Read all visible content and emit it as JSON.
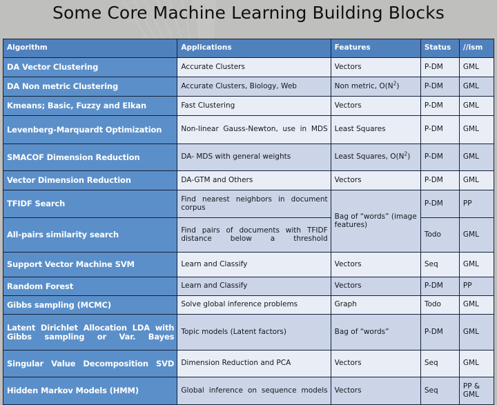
{
  "page": {
    "title": "Some Core Machine Learning Building Blocks",
    "background_color": "#bfbfbd",
    "accent_color": "#4f81bd",
    "algorithm_column_color": "#5b8fc9",
    "row_light_color": "#e9edf6",
    "row_dark_color": "#ccd5e8"
  },
  "table": {
    "columns": [
      "Algorithm",
      "Applications",
      "Features",
      "Status",
      "//ism"
    ],
    "rows": [
      {
        "algorithm": "DA Vector Clustering",
        "applications": "Accurate Clusters",
        "features": "Vectors",
        "status": "P-DM",
        "ism": "GML"
      },
      {
        "algorithm": "DA Non metric Clustering",
        "applications": "Accurate Clusters, Biology, Web",
        "features": "Non metric, O(N2)",
        "features_base": "Non metric, O(N",
        "features_sup": "2",
        "features_tail": ")",
        "status": "P-DM",
        "ism": "GML"
      },
      {
        "algorithm": "Kmeans; Basic, Fuzzy and Elkan",
        "applications": "Fast Clustering",
        "features": "Vectors",
        "status": "P-DM",
        "ism": "GML"
      },
      {
        "algorithm": "Levenberg-Marquardt Optimization",
        "applications": "Non-linear Gauss-Newton, use in MDS",
        "features": "Least Squares",
        "status": "P-DM",
        "ism": "GML"
      },
      {
        "algorithm": "SMACOF Dimension Reduction",
        "applications": "DA- MDS with general weights",
        "features": "Least Squares, O(N2)",
        "features_base": "Least         Squares, O(N",
        "features_sup": "2",
        "features_tail": ")",
        "status": "P-DM",
        "ism": "GML"
      },
      {
        "algorithm": "Vector Dimension Reduction",
        "applications": "DA-GTM and Others",
        "features": "Vectors",
        "status": "P-DM",
        "ism": "GML"
      },
      {
        "algorithm": "TFIDF Search",
        "applications": "Find nearest neighbors in document corpus",
        "features": "Bag of “words” (image features)",
        "features_rowspan": 2,
        "status": "P-DM",
        "ism": "PP"
      },
      {
        "algorithm": "All-pairs similarity search",
        "applications": "Find pairs of documents with TFIDF distance below a threshold",
        "features": null,
        "status": "Todo",
        "ism": "GML"
      },
      {
        "algorithm": "Support Vector Machine SVM",
        "applications": "Learn and Classify",
        "features": "Vectors",
        "status": "Seq",
        "ism": "GML"
      },
      {
        "algorithm": "Random Forest",
        "applications": "Learn and Classify",
        "features": "Vectors",
        "status": "P-DM",
        "ism": "PP"
      },
      {
        "algorithm": "Gibbs sampling (MCMC)",
        "applications": "Solve global inference problems",
        "features": "Graph",
        "status": "Todo",
        "ism": "GML"
      },
      {
        "algorithm": "Latent Dirichlet Allocation LDA with Gibbs sampling or Var. Bayes",
        "applications": "Topic models (Latent factors)",
        "features": "Bag of “words”",
        "status": "P-DM",
        "ism": "GML"
      },
      {
        "algorithm": "Singular Value Decomposition SVD",
        "applications": "Dimension Reduction and PCA",
        "features": "Vectors",
        "status": "Seq",
        "ism": "GML"
      },
      {
        "algorithm": "Hidden Markov Models (HMM)",
        "applications": "Global inference on sequence models",
        "features": "Vectors",
        "status": "Seq",
        "ism": "PP & GML"
      }
    ]
  }
}
